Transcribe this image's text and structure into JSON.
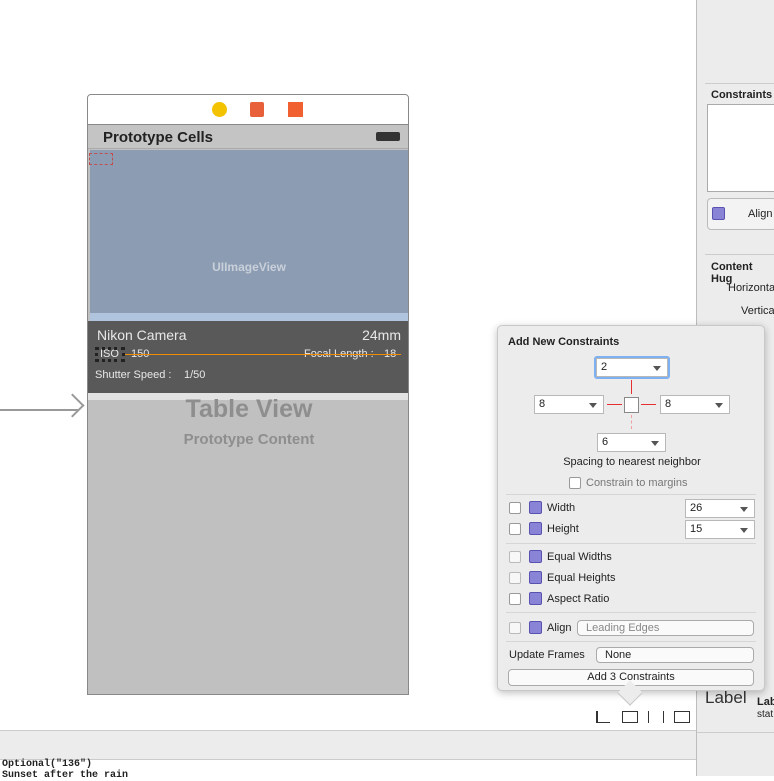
{
  "scene": {
    "nav_title": "Prototype Cells",
    "image_view": "UIImageView",
    "cell": {
      "title": "Nikon Camera",
      "focal": "24mm",
      "iso_label": "ISO",
      "iso_value": "150",
      "focal_length_label": "Focal Length :",
      "focal_length_value": "18",
      "shutter_label": "Shutter Speed :",
      "shutter_value": "1/50"
    },
    "table_title": "Table View",
    "table_sub": "Prototype Content"
  },
  "popover": {
    "title": "Add New Constraints",
    "top": "2",
    "left": "8",
    "right": "8",
    "bottom": "6",
    "spacing_label": "Spacing to nearest neighbor",
    "constrain_margins": "Constrain to margins",
    "width_label": "Width",
    "width_value": "26",
    "height_label": "Height",
    "height_value": "15",
    "equal_widths": "Equal Widths",
    "equal_heights": "Equal Heights",
    "aspect_ratio": "Aspect Ratio",
    "align_label": "Align",
    "align_value": "Leading Edges",
    "update_frames_label": "Update Frames",
    "update_frames_value": "None",
    "add_button": "Add 3 Constraints"
  },
  "inspector": {
    "constraints": "Constraints",
    "align": "Align",
    "content_hugging": "Content Hug",
    "horizontal": "Horizonta",
    "vertical": "Vertica",
    "label_big": "Label",
    "label_title": "Lab",
    "label_sub": "stat"
  },
  "console": {
    "line1": "Optional(\"136\")",
    "line2": "Sunset after the rain"
  },
  "colors": {
    "accent": "#5a9ae8",
    "orange": "#f08c00",
    "constraint_red": "#e53030"
  }
}
